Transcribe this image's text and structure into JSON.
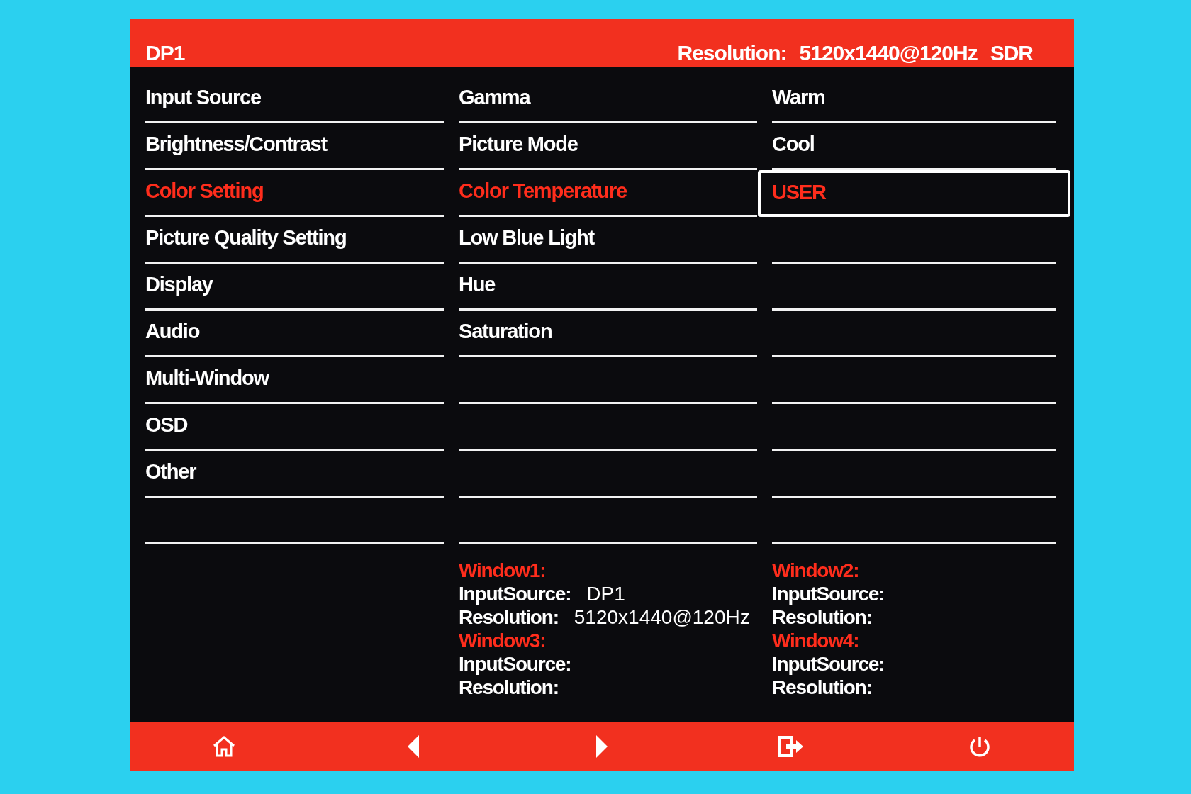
{
  "header": {
    "source": "DP1",
    "resolution_label": "Resolution:",
    "resolution": "5120x1440@120Hz",
    "dynamic_range": "SDR"
  },
  "menus": [
    {
      "items": [
        {
          "label": "Input Source",
          "selected": false
        },
        {
          "label": "Brightness/Contrast",
          "selected": false
        },
        {
          "label": "Color Setting",
          "selected": true
        },
        {
          "label": "Picture Quality Setting",
          "selected": false
        },
        {
          "label": "Display",
          "selected": false
        },
        {
          "label": "Audio",
          "selected": false
        },
        {
          "label": "Multi-Window",
          "selected": false
        },
        {
          "label": "OSD",
          "selected": false
        },
        {
          "label": "Other",
          "selected": false
        }
      ]
    },
    {
      "items": [
        {
          "label": "Gamma",
          "selected": false
        },
        {
          "label": "Picture Mode",
          "selected": false
        },
        {
          "label": "Color Temperature",
          "selected": true
        },
        {
          "label": "Low Blue Light",
          "selected": false
        },
        {
          "label": "Hue",
          "selected": false
        },
        {
          "label": "Saturation",
          "selected": false
        }
      ]
    },
    {
      "items": [
        {
          "label": "Warm",
          "selected": false
        },
        {
          "label": "Cool",
          "selected": false
        },
        {
          "label": "USER",
          "selected": true
        }
      ]
    }
  ],
  "windows": [
    {
      "title": "Window1:",
      "input_label": "InputSource:",
      "input": "DP1",
      "resolution_label": "Resolution:",
      "resolution": "5120x1440@120Hz"
    },
    {
      "title": "Window2:",
      "input_label": "InputSource:",
      "resolution_label": "Resolution:"
    },
    {
      "title": "Window3:",
      "input_label": "InputSource:",
      "resolution_label": "Resolution:"
    },
    {
      "title": "Window4:",
      "input_label": "InputSource:",
      "resolution_label": "Resolution:"
    }
  ]
}
